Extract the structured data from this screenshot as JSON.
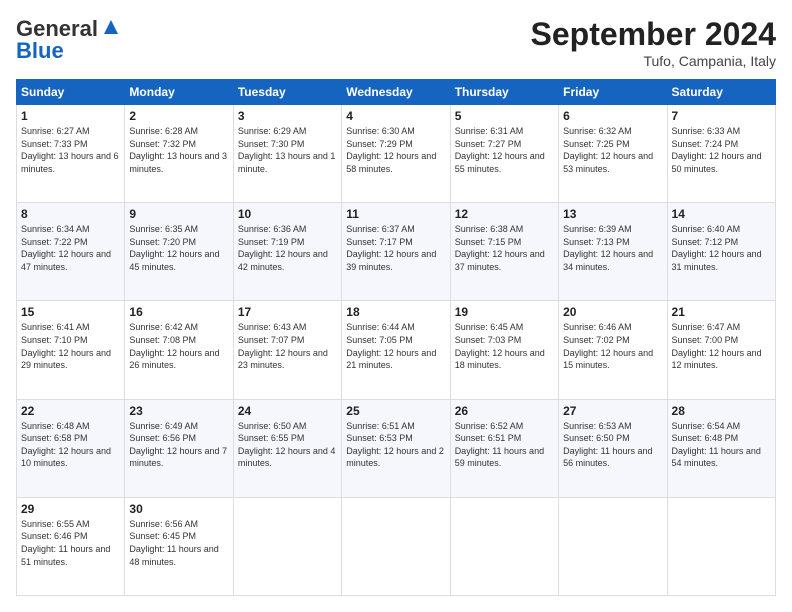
{
  "logo": {
    "line1": "General",
    "line2": "Blue"
  },
  "header": {
    "month": "September 2024",
    "location": "Tufo, Campania, Italy"
  },
  "weekdays": [
    "Sunday",
    "Monday",
    "Tuesday",
    "Wednesday",
    "Thursday",
    "Friday",
    "Saturday"
  ],
  "weeks": [
    [
      {
        "day": "1",
        "rise": "6:27 AM",
        "set": "7:33 PM",
        "daylight": "13 hours and 6 minutes."
      },
      {
        "day": "2",
        "rise": "6:28 AM",
        "set": "7:32 PM",
        "daylight": "13 hours and 3 minutes."
      },
      {
        "day": "3",
        "rise": "6:29 AM",
        "set": "7:30 PM",
        "daylight": "13 hours and 1 minute."
      },
      {
        "day": "4",
        "rise": "6:30 AM",
        "set": "7:29 PM",
        "daylight": "12 hours and 58 minutes."
      },
      {
        "day": "5",
        "rise": "6:31 AM",
        "set": "7:27 PM",
        "daylight": "12 hours and 55 minutes."
      },
      {
        "day": "6",
        "rise": "6:32 AM",
        "set": "7:25 PM",
        "daylight": "12 hours and 53 minutes."
      },
      {
        "day": "7",
        "rise": "6:33 AM",
        "set": "7:24 PM",
        "daylight": "12 hours and 50 minutes."
      }
    ],
    [
      {
        "day": "8",
        "rise": "6:34 AM",
        "set": "7:22 PM",
        "daylight": "12 hours and 47 minutes."
      },
      {
        "day": "9",
        "rise": "6:35 AM",
        "set": "7:20 PM",
        "daylight": "12 hours and 45 minutes."
      },
      {
        "day": "10",
        "rise": "6:36 AM",
        "set": "7:19 PM",
        "daylight": "12 hours and 42 minutes."
      },
      {
        "day": "11",
        "rise": "6:37 AM",
        "set": "7:17 PM",
        "daylight": "12 hours and 39 minutes."
      },
      {
        "day": "12",
        "rise": "6:38 AM",
        "set": "7:15 PM",
        "daylight": "12 hours and 37 minutes."
      },
      {
        "day": "13",
        "rise": "6:39 AM",
        "set": "7:13 PM",
        "daylight": "12 hours and 34 minutes."
      },
      {
        "day": "14",
        "rise": "6:40 AM",
        "set": "7:12 PM",
        "daylight": "12 hours and 31 minutes."
      }
    ],
    [
      {
        "day": "15",
        "rise": "6:41 AM",
        "set": "7:10 PM",
        "daylight": "12 hours and 29 minutes."
      },
      {
        "day": "16",
        "rise": "6:42 AM",
        "set": "7:08 PM",
        "daylight": "12 hours and 26 minutes."
      },
      {
        "day": "17",
        "rise": "6:43 AM",
        "set": "7:07 PM",
        "daylight": "12 hours and 23 minutes."
      },
      {
        "day": "18",
        "rise": "6:44 AM",
        "set": "7:05 PM",
        "daylight": "12 hours and 21 minutes."
      },
      {
        "day": "19",
        "rise": "6:45 AM",
        "set": "7:03 PM",
        "daylight": "12 hours and 18 minutes."
      },
      {
        "day": "20",
        "rise": "6:46 AM",
        "set": "7:02 PM",
        "daylight": "12 hours and 15 minutes."
      },
      {
        "day": "21",
        "rise": "6:47 AM",
        "set": "7:00 PM",
        "daylight": "12 hours and 12 minutes."
      }
    ],
    [
      {
        "day": "22",
        "rise": "6:48 AM",
        "set": "6:58 PM",
        "daylight": "12 hours and 10 minutes."
      },
      {
        "day": "23",
        "rise": "6:49 AM",
        "set": "6:56 PM",
        "daylight": "12 hours and 7 minutes."
      },
      {
        "day": "24",
        "rise": "6:50 AM",
        "set": "6:55 PM",
        "daylight": "12 hours and 4 minutes."
      },
      {
        "day": "25",
        "rise": "6:51 AM",
        "set": "6:53 PM",
        "daylight": "12 hours and 2 minutes."
      },
      {
        "day": "26",
        "rise": "6:52 AM",
        "set": "6:51 PM",
        "daylight": "11 hours and 59 minutes."
      },
      {
        "day": "27",
        "rise": "6:53 AM",
        "set": "6:50 PM",
        "daylight": "11 hours and 56 minutes."
      },
      {
        "day": "28",
        "rise": "6:54 AM",
        "set": "6:48 PM",
        "daylight": "11 hours and 54 minutes."
      }
    ],
    [
      {
        "day": "29",
        "rise": "6:55 AM",
        "set": "6:46 PM",
        "daylight": "11 hours and 51 minutes."
      },
      {
        "day": "30",
        "rise": "6:56 AM",
        "set": "6:45 PM",
        "daylight": "11 hours and 48 minutes."
      },
      null,
      null,
      null,
      null,
      null
    ]
  ]
}
